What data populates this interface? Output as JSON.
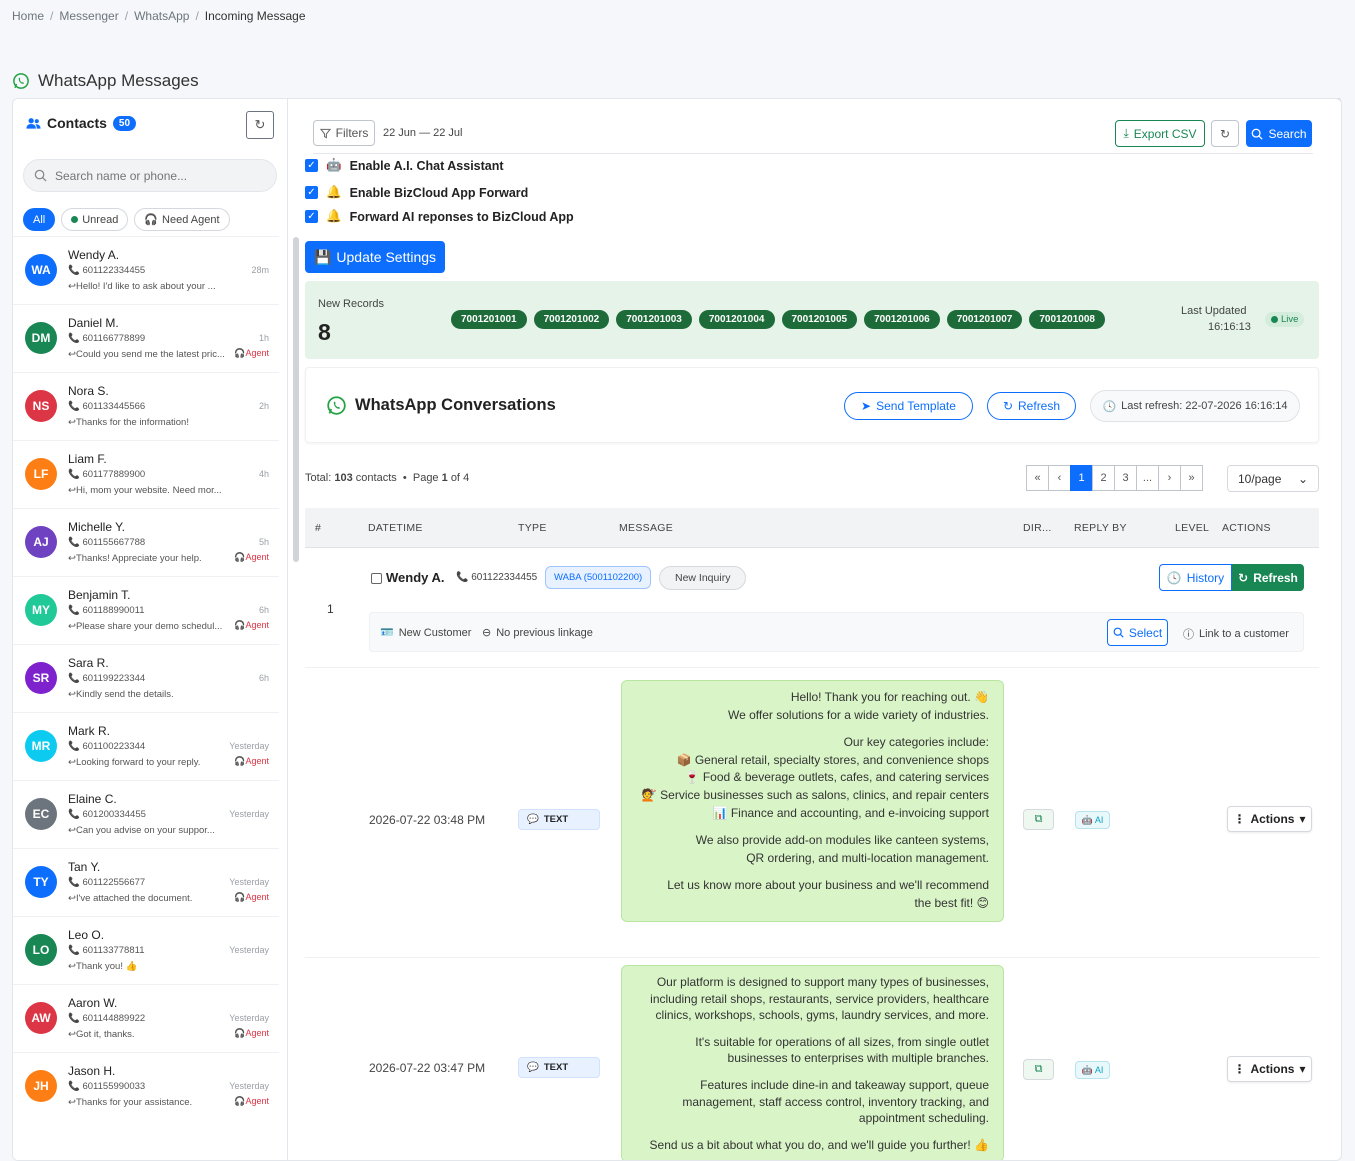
{
  "breadcrumb": [
    "Home",
    "Messenger",
    "WhatsApp",
    "Incoming Message"
  ],
  "page_title": "WhatsApp Messages",
  "sidebar": {
    "title": "Contacts",
    "count": "50",
    "search_placeholder": "Search name or phone...",
    "filters": [
      "All",
      "Unread",
      "Need Agent"
    ],
    "contacts": [
      {
        "initials": "WA",
        "name": "Wendy A.",
        "phone": "601122334455",
        "msg": "↩Hello! I'd like to ask about your ...",
        "time": "28m",
        "agent": "",
        "color": "#0d6efd"
      },
      {
        "initials": "DM",
        "name": "Daniel M.",
        "phone": "601166778899",
        "msg": "↩Could you send me the latest pric...",
        "time": "1h",
        "agent": "Agent",
        "color": "#198754"
      },
      {
        "initials": "NS",
        "name": "Nora S.",
        "phone": "601133445566",
        "msg": "↩Thanks for the information!",
        "time": "2h",
        "agent": "",
        "color": "#dc3545"
      },
      {
        "initials": "LF",
        "name": "Liam F.",
        "phone": "601177889900",
        "msg": "↩Hi, mom your website. Need mor...",
        "time": "4h",
        "agent": "",
        "color": "#fd7e14"
      },
      {
        "initials": "AJ",
        "name": "Michelle Y.",
        "phone": "601155667788",
        "msg": "↩Thanks! Appreciate your help.",
        "time": "5h",
        "agent": "Agent",
        "color": "#6f42c1"
      },
      {
        "initials": "MY",
        "name": "Benjamin T.",
        "phone": "601188990011",
        "msg": "↩Please share your demo schedul...",
        "time": "6h",
        "agent": "Agent",
        "color": "#20c997"
      },
      {
        "initials": "SR",
        "name": "Sara R.",
        "phone": "601199223344",
        "msg": "↩Kindly send the details.",
        "time": "6h",
        "agent": "",
        "color": "#7e22ce"
      },
      {
        "initials": "MR",
        "name": "Mark R.",
        "phone": "601100223344",
        "msg": "↩Looking forward to your reply.",
        "time": "Yesterday",
        "agent": "Agent",
        "color": "#0dcaf0"
      },
      {
        "initials": "EC",
        "name": "Elaine C.",
        "phone": "601200334455",
        "msg": "↩Can you advise on your suppor...",
        "time": "Yesterday",
        "agent": "",
        "color": "#6c757d"
      },
      {
        "initials": "TY",
        "name": "Tan Y.",
        "phone": "601122556677",
        "msg": "↩I've attached the document.",
        "time": "Yesterday",
        "agent": "Agent",
        "color": "#0d6efd"
      },
      {
        "initials": "LO",
        "name": "Leo O.",
        "phone": "601133778811",
        "msg": "↩Thank you! 👍",
        "time": "Yesterday",
        "agent": "",
        "color": "#198754"
      },
      {
        "initials": "AW",
        "name": "Aaron W.",
        "phone": "601144889922",
        "msg": "↩Got it, thanks.",
        "time": "Yesterday",
        "agent": "Agent",
        "color": "#dc3545"
      },
      {
        "initials": "JH",
        "name": "Jason H.",
        "phone": "601155990033",
        "msg": "↩Thanks for your assistance.",
        "time": "Yesterday",
        "agent": "Agent",
        "color": "#fd7e14"
      }
    ]
  },
  "toolbar": {
    "filters_label": "Filters",
    "date_range": "22 Jun — 22 Jul",
    "export_label": "Export CSV",
    "search_label": "Search"
  },
  "settings": {
    "ai_assistant": "Enable A.I. Chat Assistant",
    "bizcloud_forward": "Enable BizCloud App Forward",
    "ai_forward": "Forward AI reponses to BizCloud App",
    "update_label": "Update Settings"
  },
  "records": {
    "label": "New Records",
    "count": "8",
    "ids": [
      "7001201001",
      "7001201002",
      "7001201003",
      "7001201004",
      "7001201005",
      "7001201006",
      "7001201007",
      "7001201008"
    ],
    "last_updated_label": "Last Updated",
    "last_updated_time": "16:16:13",
    "live_label": "Live"
  },
  "conversations": {
    "title": "WhatsApp Conversations",
    "send_template_label": "Send Template",
    "refresh_label": "Refresh",
    "last_refresh": "Last refresh: 22-07-2026 16:16:14"
  },
  "pagination": {
    "total_label": "Total:",
    "total_count": "103",
    "contacts_word": "contacts",
    "bullet": "•",
    "page_word": "Page",
    "page_current": "1",
    "of_word": "of",
    "page_total": "4",
    "pages": [
      "«",
      "‹",
      "1",
      "2",
      "3",
      "...",
      "›",
      "»"
    ],
    "per_page": "10/page"
  },
  "table": {
    "headers": [
      "#",
      "DATETIME",
      "TYPE",
      "MESSAGE",
      "DIR...",
      "REPLY BY",
      "LEVEL",
      "ACTIONS"
    ]
  },
  "conversation_row": {
    "num": "1",
    "name": "Wendy A.",
    "phone": "601122334455",
    "waba": "WABA (5001102200)",
    "status": "New Inquiry",
    "history_label": "History",
    "refresh_label": "Refresh",
    "new_customer": "New Customer",
    "no_linkage": "No previous linkage",
    "select_label": "Select",
    "link_label": "Link to a customer"
  },
  "messages": [
    {
      "datetime": "2026-07-22 03:48 PM",
      "type": "TEXT",
      "reply_by": "AI",
      "actions_label": "Actions",
      "lines": [
        "Hello! Thank you for reaching out. 👋",
        "We offer solutions for a wide variety of industries.",
        "",
        "Our key categories include:",
        "📦 General retail, specialty stores, and convenience shops",
        "🍷 Food & beverage outlets, cafes, and catering services",
        "💇 Service businesses such as salons, clinics, and repair centers",
        "📊 Finance and accounting, and e-invoicing support",
        "",
        "We also provide add-on modules like canteen systems,",
        "QR ordering, and multi-location management.",
        "",
        "Let us know more about your business and we'll recommend",
        "the best fit! 😊"
      ]
    },
    {
      "datetime": "2026-07-22 03:47 PM",
      "type": "TEXT",
      "reply_by": "AI",
      "actions_label": "Actions",
      "lines": [
        "Our platform is designed to support many types of businesses,",
        "including retail shops, restaurants, service providers, healthcare",
        "clinics, workshops, schools, gyms, laundry services, and more.",
        "",
        "It's suitable for operations of all sizes, from single outlet",
        "businesses to enterprises with multiple branches.",
        "",
        "Features include dine-in and takeaway support, queue",
        "management, staff access control, inventory tracking, and",
        "appointment scheduling.",
        "",
        "Send us a bit about what you do, and we'll guide you further! 👍"
      ]
    }
  ]
}
